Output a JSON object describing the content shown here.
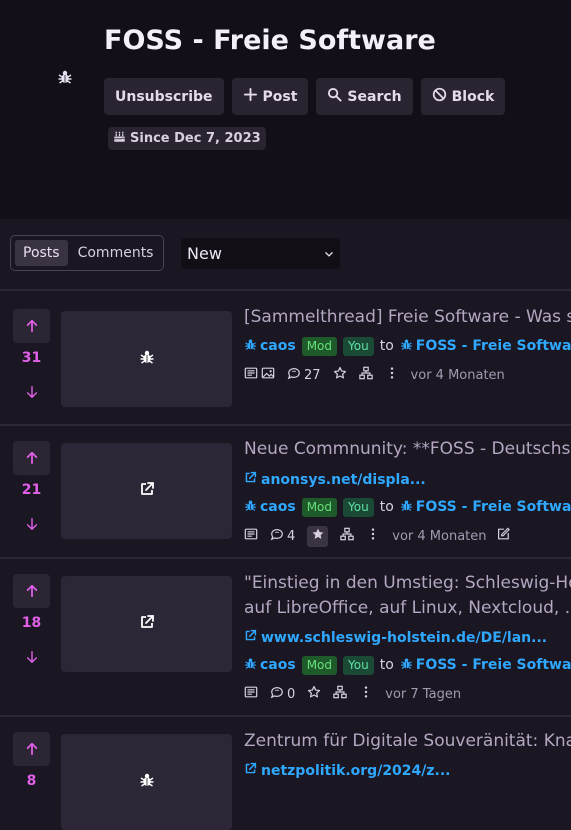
{
  "community": {
    "title": "FOSS - Freie Software",
    "icon": "bug-icon",
    "since": "Since Dec 7, 2023"
  },
  "buttons": {
    "unsubscribe": "Unsubscribe",
    "post": "Post",
    "search": "Search",
    "block": "Block"
  },
  "view_toggle": {
    "posts": "Posts",
    "comments": "Comments",
    "active": "Posts"
  },
  "sort": {
    "selected": "New"
  },
  "colors": {
    "accent": "#e060e8",
    "link": "#2fa8ff",
    "mod_badge": "#1f5a2a",
    "you_badge": "#1a4a36"
  },
  "posts": [
    {
      "score": "31",
      "title": "[Sammelthread] Freie Software - Was s",
      "thumb_icon": "bug-icon",
      "user": "caos",
      "mod": "Mod",
      "you": "You",
      "to": "to",
      "community": "FOSS - Freie Software",
      "comments": "27",
      "time": "vor 4 Monaten"
    },
    {
      "score": "21",
      "title": "Neue Commnunity: **FOSS - Deutschsp",
      "thumb_icon": "external-link-icon",
      "link": "anonsys.net/displa...",
      "user": "caos",
      "mod": "Mod",
      "you": "You",
      "to": "to",
      "community": "FOSS - Freie Software",
      "comments": "4",
      "time": "vor 4 Monaten"
    },
    {
      "score": "18",
      "title_line1": "\"Einstieg in den Umstieg: Schleswig-Ho",
      "title_line2": "auf LibreOffice, auf Linux, Nextcloud, ..",
      "thumb_icon": "external-link-icon",
      "link": "www.schleswig-holstein.de/DE/lan...",
      "user": "caos",
      "mod": "Mod",
      "you": "You",
      "to": "to",
      "community": "FOSS - Freie Software",
      "comments": "0",
      "time": "vor 7 Tagen"
    },
    {
      "score": "8",
      "title": "Zentrum für Digitale Souveränität: Kna",
      "thumb_icon": "bug-icon",
      "link": "netzpolitik.org/2024/z..."
    }
  ]
}
